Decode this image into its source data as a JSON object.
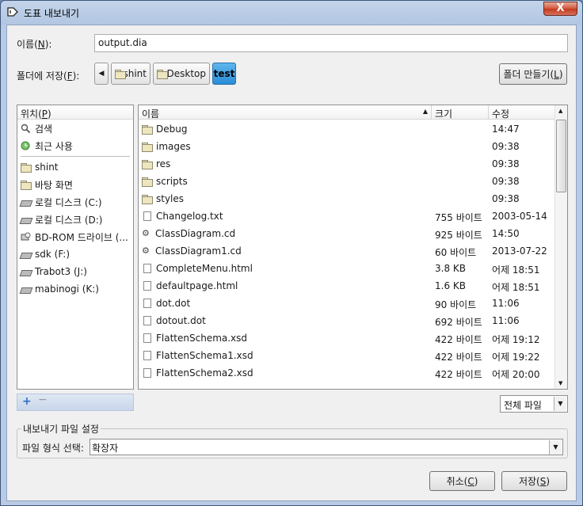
{
  "window": {
    "title": "도표 내보내기",
    "close_label": "X"
  },
  "name_field": {
    "label_prefix": "이름(",
    "label_key": "N",
    "label_suffix": "):",
    "value": "output.dia"
  },
  "save_in": {
    "label_prefix": "폴더에 저장(",
    "label_key": "F",
    "label_suffix": "):"
  },
  "breadcrumbs": [
    "shint",
    "Desktop",
    "test"
  ],
  "create_folder": {
    "prefix": "폴더 만들기(",
    "key": "L",
    "suffix": ")"
  },
  "places": {
    "header_prefix": "위치(",
    "header_key": "P",
    "header_suffix": ")",
    "items": [
      {
        "label": "검색",
        "icon": "search-icon"
      },
      {
        "label": "최근 사용",
        "icon": "recent-icon"
      },
      {
        "label": "shint",
        "icon": "folder-icon"
      },
      {
        "label": "바탕 화면",
        "icon": "folder-icon"
      },
      {
        "label": "로컬 디스크 (C:)",
        "icon": "drive-icon"
      },
      {
        "label": "로컬 디스크 (D:)",
        "icon": "drive-icon"
      },
      {
        "label": "BD-ROM 드라이브 (...",
        "icon": "optical-drive-icon"
      },
      {
        "label": "sdk (F:)",
        "icon": "drive-icon"
      },
      {
        "label": "Trabot3 (J:)",
        "icon": "drive-icon"
      },
      {
        "label": "mabinogi (K:)",
        "icon": "drive-icon"
      }
    ]
  },
  "files": {
    "columns": {
      "name": "이름",
      "size": "크기",
      "modified": "수정"
    },
    "rows": [
      {
        "name": "Debug",
        "size": "",
        "modified": "14:47",
        "icon": "folder-icon"
      },
      {
        "name": "images",
        "size": "",
        "modified": "09:38",
        "icon": "folder-icon"
      },
      {
        "name": "res",
        "size": "",
        "modified": "09:38",
        "icon": "folder-icon"
      },
      {
        "name": "scripts",
        "size": "",
        "modified": "09:38",
        "icon": "folder-icon"
      },
      {
        "name": "styles",
        "size": "",
        "modified": "09:38",
        "icon": "folder-icon"
      },
      {
        "name": "Changelog.txt",
        "size": "755 바이트",
        "modified": "2003-05-14",
        "icon": "document-icon"
      },
      {
        "name": "ClassDiagram.cd",
        "size": "925 바이트",
        "modified": "14:50",
        "icon": "diagram-icon"
      },
      {
        "name": "ClassDiagram1.cd",
        "size": "60 바이트",
        "modified": "2013-07-22",
        "icon": "diagram-icon"
      },
      {
        "name": "CompleteMenu.html",
        "size": "3.8 KB",
        "modified": "어제 18:51",
        "icon": "document-icon"
      },
      {
        "name": "defaultpage.html",
        "size": "1.6 KB",
        "modified": "어제 18:51",
        "icon": "document-icon"
      },
      {
        "name": "dot.dot",
        "size": "90 바이트",
        "modified": "11:06",
        "icon": "document-icon"
      },
      {
        "name": "dotout.dot",
        "size": "692 바이트",
        "modified": "11:06",
        "icon": "document-icon"
      },
      {
        "name": "FlattenSchema.xsd",
        "size": "422 바이트",
        "modified": "어제 19:12",
        "icon": "document-icon"
      },
      {
        "name": "FlattenSchema1.xsd",
        "size": "422 바이트",
        "modified": "어제 19:22",
        "icon": "document-icon"
      },
      {
        "name": "FlattenSchema2.xsd",
        "size": "422 바이트",
        "modified": "어제 20:00",
        "icon": "document-icon"
      }
    ]
  },
  "filter": {
    "value": "전체 파일"
  },
  "export_settings": {
    "group_label": "내보내기 파일 설정",
    "format_label": "파일 형식 선택:",
    "format_value": "확장자"
  },
  "buttons": {
    "cancel_prefix": "취소(",
    "cancel_key": "C",
    "cancel_suffix": ")",
    "save_prefix": "저장(",
    "save_key": "S",
    "save_suffix": ")"
  },
  "colors": {
    "accent": "#2b8cd6",
    "titlebar": "#b9cbe4",
    "close": "#c2391b"
  }
}
